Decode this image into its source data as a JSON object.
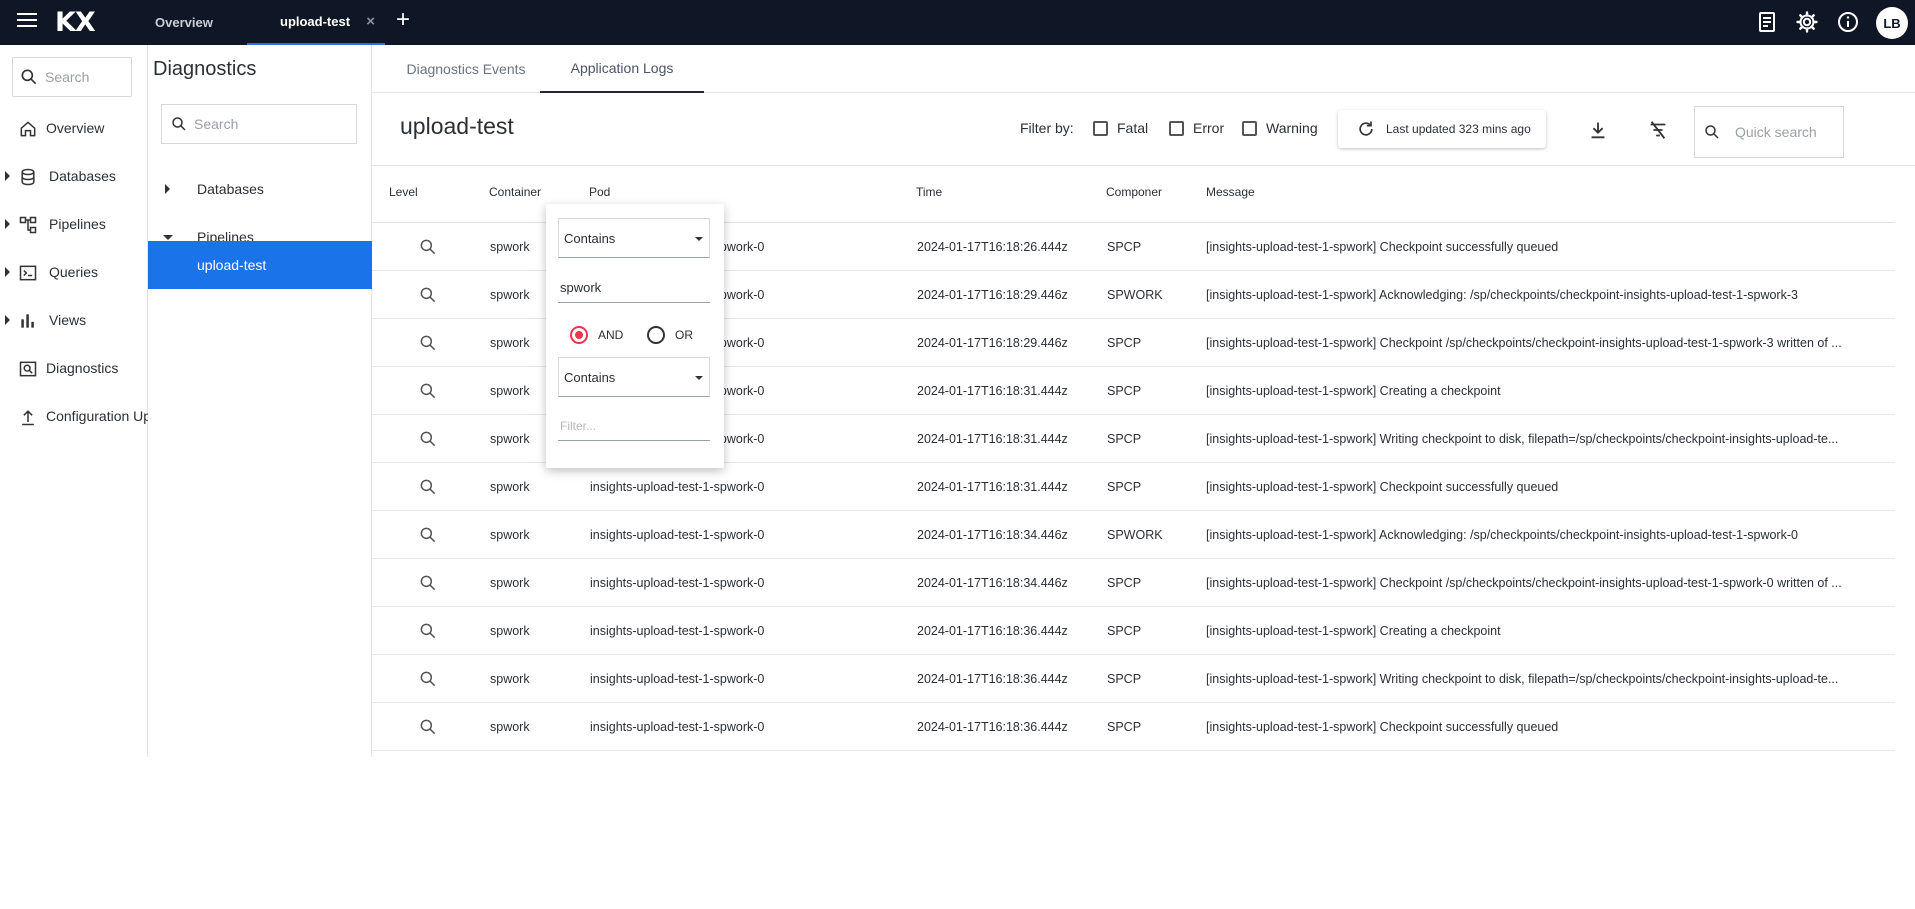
{
  "app": {
    "logo_text": "KX",
    "tabs": [
      {
        "label": "Overview",
        "active": false
      },
      {
        "label": "upload-test",
        "active": true,
        "close_glyph": "×"
      }
    ],
    "add_tab_glyph": "+",
    "top_icons": [
      "document-icon",
      "gear-icon",
      "info-icon"
    ],
    "avatar_initials": "LB"
  },
  "leftnav": {
    "search_placeholder": "Search",
    "items": [
      {
        "label": "Overview",
        "icon": "home-icon",
        "expandable": false
      },
      {
        "label": "Databases",
        "icon": "database-icon",
        "expandable": true
      },
      {
        "label": "Pipelines",
        "icon": "pipeline-icon",
        "expandable": true
      },
      {
        "label": "Queries",
        "icon": "terminal-icon",
        "expandable": true
      },
      {
        "label": "Views",
        "icon": "bar-chart-icon",
        "expandable": true
      },
      {
        "label": "Diagnostics",
        "icon": "diagnostics-icon",
        "expandable": false
      },
      {
        "label": "Configuration Up",
        "icon": "upload-icon",
        "expandable": false
      }
    ]
  },
  "tree": {
    "title": "Diagnostics",
    "search_placeholder": "Search",
    "items": [
      {
        "label": "Databases",
        "state": "collapsed"
      },
      {
        "label": "Pipelines",
        "state": "expanded"
      },
      {
        "label": "upload-test",
        "state": "selected"
      }
    ]
  },
  "main": {
    "subtabs": [
      {
        "label": "Diagnostics Events",
        "active": false
      },
      {
        "label": "Application Logs",
        "active": true
      }
    ],
    "title": "upload-test",
    "filter_label": "Filter by:",
    "filters": [
      {
        "label": "Fatal",
        "checked": false
      },
      {
        "label": "Error",
        "checked": false
      },
      {
        "label": "Warning",
        "checked": false
      }
    ],
    "refresh_label": "Last updated 323 mins ago",
    "quick_search_placeholder": "Quick search",
    "columns": [
      "Level",
      "Container",
      "Pod",
      "Time",
      "Componer",
      "Message"
    ],
    "rows": [
      {
        "container": "spwork",
        "pod": "insights-upload-test-1-spwork-0",
        "time": "2024-01-17T16:18:26.444z",
        "component": "SPCP",
        "message": "[insights-upload-test-1-spwork] Checkpoint successfully queued"
      },
      {
        "container": "spwork",
        "pod": "insights-upload-test-1-spwork-0",
        "time": "2024-01-17T16:18:29.446z",
        "component": "SPWORK",
        "message": "[insights-upload-test-1-spwork] Acknowledging: /sp/checkpoints/checkpoint-insights-upload-test-1-spwork-3"
      },
      {
        "container": "spwork",
        "pod": "insights-upload-test-1-spwork-0",
        "time": "2024-01-17T16:18:29.446z",
        "component": "SPCP",
        "message": "[insights-upload-test-1-spwork] Checkpoint /sp/checkpoints/checkpoint-insights-upload-test-1-spwork-3 written of ..."
      },
      {
        "container": "spwork",
        "pod": "insights-upload-test-1-spwork-0",
        "time": "2024-01-17T16:18:31.444z",
        "component": "SPCP",
        "message": "[insights-upload-test-1-spwork] Creating a checkpoint"
      },
      {
        "container": "spwork",
        "pod": "insights-upload-test-1-spwork-0",
        "time": "2024-01-17T16:18:31.444z",
        "component": "SPCP",
        "message": "[insights-upload-test-1-spwork] Writing checkpoint to disk, filepath=/sp/checkpoints/checkpoint-insights-upload-te..."
      },
      {
        "container": "spwork",
        "pod": "insights-upload-test-1-spwork-0",
        "time": "2024-01-17T16:18:31.444z",
        "component": "SPCP",
        "message": "[insights-upload-test-1-spwork] Checkpoint successfully queued"
      },
      {
        "container": "spwork",
        "pod": "insights-upload-test-1-spwork-0",
        "time": "2024-01-17T16:18:34.446z",
        "component": "SPWORK",
        "message": "[insights-upload-test-1-spwork] Acknowledging: /sp/checkpoints/checkpoint-insights-upload-test-1-spwork-0"
      },
      {
        "container": "spwork",
        "pod": "insights-upload-test-1-spwork-0",
        "time": "2024-01-17T16:18:34.446z",
        "component": "SPCP",
        "message": "[insights-upload-test-1-spwork] Checkpoint /sp/checkpoints/checkpoint-insights-upload-test-1-spwork-0 written of ..."
      },
      {
        "container": "spwork",
        "pod": "insights-upload-test-1-spwork-0",
        "time": "2024-01-17T16:18:36.444z",
        "component": "SPCP",
        "message": "[insights-upload-test-1-spwork] Creating a checkpoint"
      },
      {
        "container": "spwork",
        "pod": "insights-upload-test-1-spwork-0",
        "time": "2024-01-17T16:18:36.444z",
        "component": "SPCP",
        "message": "[insights-upload-test-1-spwork] Writing checkpoint to disk, filepath=/sp/checkpoints/checkpoint-insights-upload-te..."
      },
      {
        "container": "spwork",
        "pod": "insights-upload-test-1-spwork-0",
        "time": "2024-01-17T16:18:36.444z",
        "component": "SPCP",
        "message": "[insights-upload-test-1-spwork] Checkpoint successfully queued"
      }
    ]
  },
  "filter_popup": {
    "condition1": "Contains",
    "value1": "spwork",
    "operator_and": "AND",
    "operator_or": "OR",
    "selected_operator": "AND",
    "condition2": "Contains",
    "value2_placeholder": "Filter..."
  },
  "colors": {
    "topbar": "#0f1726",
    "accent": "#1a73e8",
    "radio": "#e8374f"
  }
}
